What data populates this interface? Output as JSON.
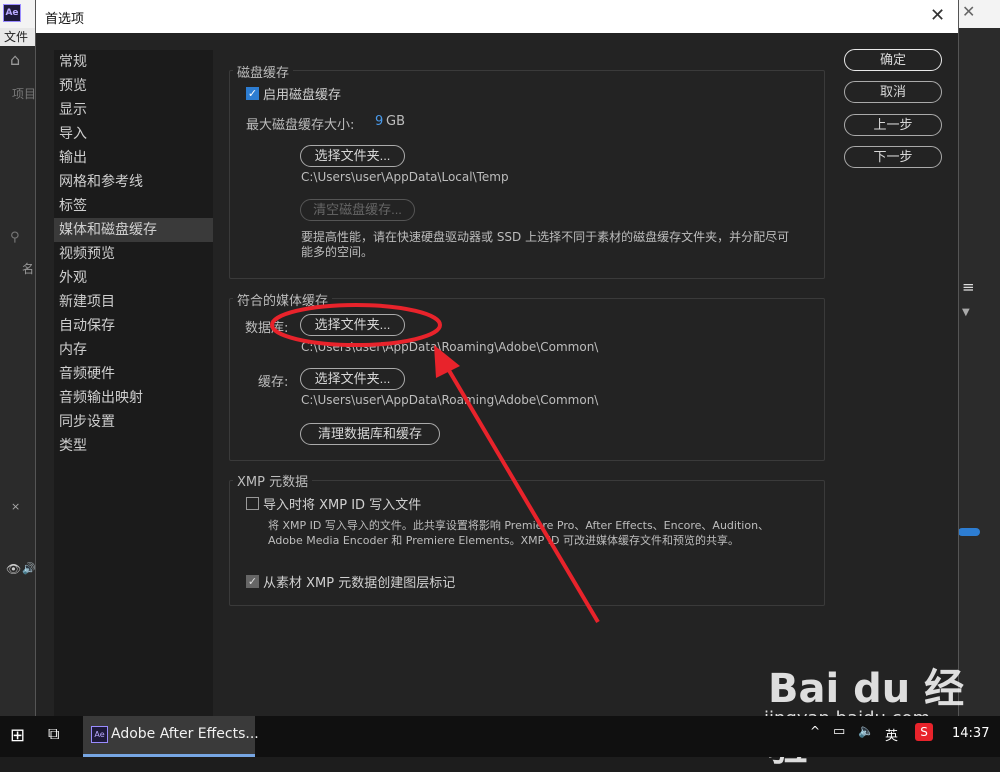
{
  "dialog": {
    "title": "首选项",
    "close_symbol": "✕"
  },
  "background_app": {
    "title": "Ae",
    "menu_partial": "文件",
    "panel_text_1": "项目",
    "panel_text_2": "名"
  },
  "nav": {
    "items": [
      {
        "label": "常规"
      },
      {
        "label": "预览"
      },
      {
        "label": "显示"
      },
      {
        "label": "导入"
      },
      {
        "label": "输出"
      },
      {
        "label": "网格和参考线"
      },
      {
        "label": "标签"
      },
      {
        "label": "媒体和磁盘缓存"
      },
      {
        "label": "视频预览"
      },
      {
        "label": "外观"
      },
      {
        "label": "新建项目"
      },
      {
        "label": "自动保存"
      },
      {
        "label": "内存"
      },
      {
        "label": "音频硬件"
      },
      {
        "label": "音频输出映射"
      },
      {
        "label": "同步设置"
      },
      {
        "label": "类型"
      }
    ],
    "selected": "媒体和磁盘缓存"
  },
  "right_buttons": {
    "ok": "确定",
    "cancel": "取消",
    "prev": "上一步",
    "next": "下一步"
  },
  "disk_cache": {
    "title": "磁盘缓存",
    "enable_label": "启用磁盘缓存",
    "enable_checked": true,
    "max_size_label": "最大磁盘缓存大小:",
    "max_size_value": "9",
    "max_size_unit": "GB",
    "choose_folder": "选择文件夹...",
    "path": "C:\\Users\\user\\AppData\\Local\\Temp",
    "clear_button": "清空磁盘缓存...",
    "hint": "要提高性能，请在快速硬盘驱动器或 SSD 上选择不同于素材的磁盘缓存文件夹，并分配尽可能多的空间。"
  },
  "media_cache": {
    "title": "符合的媒体缓存",
    "database_label": "数据库:",
    "database_button": "选择文件夹...",
    "database_path": "C:\\Users\\user\\AppData\\Roaming\\Adobe\\Common\\",
    "cache_label": "缓存:",
    "cache_button": "选择文件夹...",
    "cache_path": "C:\\Users\\user\\AppData\\Roaming\\Adobe\\Common\\",
    "clean_button": "清理数据库和缓存"
  },
  "xmp": {
    "title": "XMP 元数据",
    "write_id_label": "导入时将 XMP ID 写入文件",
    "write_id_checked": false,
    "desc_line1": "将 XMP ID 写入导入的文件。此共享设置将影响 Premiere Pro、After Effects、Encore、Audition、",
    "desc_line2": "Adobe Media Encoder 和 Premiere Elements。XMP ID 可改进媒体缓存文件和预览的共享。",
    "layer_markers_label": "从素材 XMP 元数据创建图层标记",
    "layer_markers_checked": true
  },
  "taskbar": {
    "app_label": "Adobe After Effects...",
    "ime": "英",
    "time": "14:37"
  },
  "watermark": {
    "logo": "Bai du 经验",
    "url": "jingyan.baidu.com"
  },
  "colors": {
    "accent": "#2d7dd2",
    "annotation_red": "#e8232b",
    "dialog_bg": "#232323"
  }
}
